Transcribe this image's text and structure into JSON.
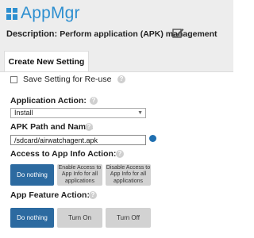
{
  "header": {
    "app_title": "AppMgr",
    "description_label": "Description:",
    "description_text": "Perform application (APK) management"
  },
  "tabs": [
    {
      "label": "Create New Setting"
    }
  ],
  "form": {
    "save_setting_label": "Save Setting for Re-use",
    "application_action": {
      "label": "Application Action:",
      "selected_value": "Install"
    },
    "apk_path": {
      "label": "APK Path and Name:",
      "value": "/sdcard/airwatchagent.apk"
    },
    "app_info_access": {
      "label": "Access to App Info Action:",
      "options": [
        {
          "label": "Do nothing"
        },
        {
          "label": "Enable Access to App Info for all applications"
        },
        {
          "label": "Disable Access to App Info for all applications"
        }
      ],
      "selected": "Do nothing"
    },
    "app_feature": {
      "label": "App Feature Action:",
      "options": [
        {
          "label": "Do nothing"
        },
        {
          "label": "Turn On"
        },
        {
          "label": "Turn Off"
        }
      ],
      "selected": "Do nothing"
    }
  },
  "colors": {
    "brand": "#2d8fd0",
    "active_button": "#2c6aa0",
    "inactive_button": "#d2d2d2",
    "header_bg": "#ededed"
  },
  "icons": {
    "logo": "app-grid-logo",
    "edit": "pencil-square-icon",
    "help": "question-circle-icon",
    "browse": "browse-circle-icon",
    "dropdown": "triangle-down-icon"
  }
}
